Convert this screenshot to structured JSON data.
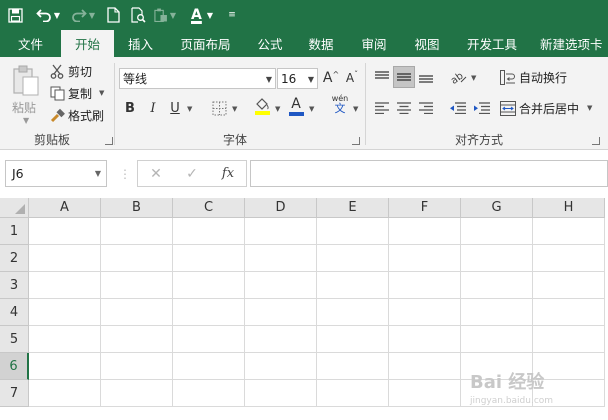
{
  "colors": {
    "accent": "#217346",
    "ribbon_bg": "#f3f3f3",
    "header_bg": "#e6e6e6",
    "grid_line": "#dadada"
  },
  "qat": {
    "icons": [
      "save-icon",
      "undo-icon",
      "redo-icon",
      "new-file-icon",
      "print-preview-icon",
      "paste-icon",
      "font-color-icon",
      "customize-icon"
    ]
  },
  "tabs": [
    "文件",
    "开始",
    "插入",
    "页面布局",
    "公式",
    "数据",
    "审阅",
    "视图",
    "开发工具",
    "新建选项卡"
  ],
  "active_tab": "开始",
  "clipboard": {
    "paste_label": "粘贴",
    "cut_label": "剪切",
    "copy_label": "复制",
    "format_painter_label": "格式刷",
    "group_label": "剪贴板"
  },
  "font": {
    "font_name": "等线",
    "font_size": "16",
    "bold": "B",
    "italic": "I",
    "underline": "U",
    "font_color_letter": "A",
    "phonetic_label": "wén",
    "phonetic_char": "文",
    "group_label": "字体"
  },
  "alignment": {
    "wrap_text_label": "自动换行",
    "merge_center_label": "合并后居中",
    "group_label": "对齐方式"
  },
  "formula_bar": {
    "name_box": "J6",
    "cancel": "✕",
    "enter": "✓",
    "fx": "fx",
    "value": ""
  },
  "sheet": {
    "columns": [
      "A",
      "B",
      "C",
      "D",
      "E",
      "F",
      "G",
      "H"
    ],
    "rows": [
      "1",
      "2",
      "3",
      "4",
      "5",
      "6",
      "7"
    ],
    "active_row": "6"
  },
  "watermark": {
    "text": "Bai 经验",
    "sub": "jingyan.baidu.com"
  }
}
